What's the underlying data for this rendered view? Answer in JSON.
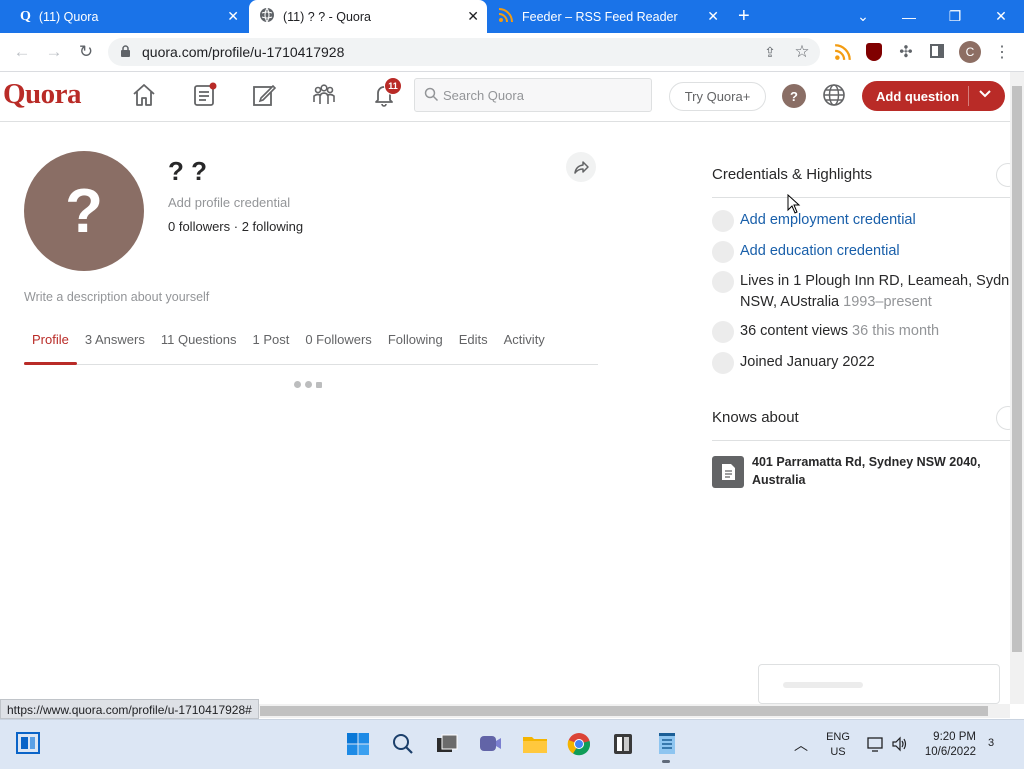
{
  "browser": {
    "tabs": [
      {
        "title": "(11) Quora",
        "active": false
      },
      {
        "title": "(11) ? ? - Quora",
        "active": true
      },
      {
        "title": "Feeder – RSS Feed Reader",
        "active": false
      }
    ],
    "url": "quora.com/profile/u-1710417928",
    "status_url": "https://www.quora.com/profile/u-1710417928#"
  },
  "quora": {
    "logo": "Quora",
    "notification_count": "11",
    "search_placeholder": "Search Quora",
    "try_plus": "Try Quora+",
    "add_question": "Add question"
  },
  "profile": {
    "avatar_glyph": "?",
    "name": "? ?",
    "credential_prompt": "Add profile credential",
    "followers_line": "0 followers · 2 following",
    "description_prompt": "Write a description about yourself",
    "tabs": [
      "Profile",
      "3 Answers",
      "11 Questions",
      "1 Post",
      "0 Followers",
      "Following",
      "Edits",
      "Activity"
    ]
  },
  "sidebar": {
    "credentials_title": "Credentials & Highlights",
    "add_employment": "Add employment credential",
    "add_education": "Add education credential",
    "lives_in": "Lives in 1 Plough Inn RD, Leameah, Sydn",
    "lives_in_cont": "NSW, AUstralia",
    "lives_in_period": "1993–present",
    "content_views": "36 content views",
    "content_views_month": "36 this month",
    "joined": "Joined January 2022",
    "knows_title": "Knows about",
    "knows_item": "401 Parramatta Rd, Sydney NSW 2040, Australia"
  },
  "taskbar": {
    "lang_top": "ENG",
    "lang_bottom": "US",
    "time": "9:20 PM",
    "date": "10/6/2022",
    "notifications": "3"
  },
  "colors": {
    "quora_red": "#b92b27",
    "chrome_blue": "#1a73e8",
    "link_blue": "#195faa"
  }
}
